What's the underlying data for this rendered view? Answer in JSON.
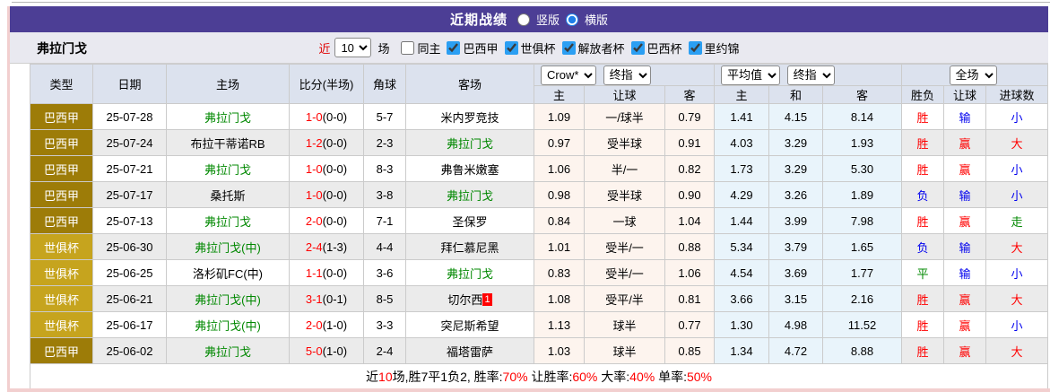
{
  "topbar": {
    "title": "近期战绩",
    "radio_vertical": "竖版",
    "radio_horizontal": "横版",
    "bar_color": "#4c3e95"
  },
  "filter": {
    "team": "弗拉门戈",
    "recent_label": "近",
    "recent_value": "10",
    "games_label": "场",
    "checkboxes": [
      {
        "label": "同主",
        "checked": false
      },
      {
        "label": "巴西甲",
        "checked": true
      },
      {
        "label": "世俱杯",
        "checked": true
      },
      {
        "label": "解放者杯",
        "checked": true
      },
      {
        "label": "巴西杯",
        "checked": true
      },
      {
        "label": "里约锦",
        "checked": true
      }
    ]
  },
  "table": {
    "headers": {
      "type": "类型",
      "date": "日期",
      "home": "主场",
      "score": "比分(半场)",
      "corner": "角球",
      "away": "客场",
      "crow_select": "Crow*",
      "crow_final_select": "终指",
      "avg_select": "平均值",
      "avg_final_select": "终指",
      "scope_select": "全场",
      "sub_home": "主",
      "sub_handicap": "让球",
      "sub_away": "客",
      "sub_avg_home": "主",
      "sub_avg_draw": "和",
      "sub_avg_away": "客",
      "sub_result": "胜负",
      "sub_handicap_result": "让球",
      "sub_goals": "进球数"
    },
    "type_colors": {
      "league": "#9d7c08",
      "cup": "#c6a41e"
    },
    "rows": [
      {
        "type": "巴西甲",
        "type_style": "league",
        "date": "25-07-28",
        "home": "弗拉门戈",
        "home_color": "green",
        "score": "1-0",
        "half": "(0-0)",
        "corner": "5-7",
        "away": "米内罗竞技",
        "away_color": "black",
        "away_badge": "",
        "odds_home": "1.09",
        "handicap": "一/球半",
        "odds_away": "0.79",
        "avg_home": "1.41",
        "avg_draw": "4.15",
        "avg_away": "8.14",
        "result": "胜",
        "result_color": "red",
        "hresult": "输",
        "hresult_color": "blue",
        "goals": "小",
        "goals_color": "blue"
      },
      {
        "type": "巴西甲",
        "type_style": "league",
        "date": "25-07-24",
        "home": "布拉干蒂诺RB",
        "home_color": "black",
        "score": "1-2",
        "half": "(0-0)",
        "corner": "2-3",
        "away": "弗拉门戈",
        "away_color": "green",
        "away_badge": "",
        "odds_home": "0.97",
        "handicap": "受半球",
        "odds_away": "0.91",
        "avg_home": "4.03",
        "avg_draw": "3.29",
        "avg_away": "1.93",
        "result": "胜",
        "result_color": "red",
        "hresult": "赢",
        "hresult_color": "red",
        "goals": "大",
        "goals_color": "red"
      },
      {
        "type": "巴西甲",
        "type_style": "league",
        "date": "25-07-21",
        "home": "弗拉门戈",
        "home_color": "green",
        "score": "1-0",
        "half": "(0-0)",
        "corner": "8-3",
        "away": "弗鲁米嫩塞",
        "away_color": "black",
        "away_badge": "",
        "odds_home": "1.06",
        "handicap": "半/一",
        "odds_away": "0.82",
        "avg_home": "1.73",
        "avg_draw": "3.29",
        "avg_away": "5.30",
        "result": "胜",
        "result_color": "red",
        "hresult": "赢",
        "hresult_color": "red",
        "goals": "小",
        "goals_color": "blue"
      },
      {
        "type": "巴西甲",
        "type_style": "league",
        "date": "25-07-17",
        "home": "桑托斯",
        "home_color": "black",
        "score": "1-0",
        "half": "(0-0)",
        "corner": "3-8",
        "away": "弗拉门戈",
        "away_color": "green",
        "away_badge": "",
        "odds_home": "0.98",
        "handicap": "受半球",
        "odds_away": "0.90",
        "avg_home": "4.29",
        "avg_draw": "3.26",
        "avg_away": "1.89",
        "result": "负",
        "result_color": "blue",
        "hresult": "输",
        "hresult_color": "blue",
        "goals": "小",
        "goals_color": "blue"
      },
      {
        "type": "巴西甲",
        "type_style": "league",
        "date": "25-07-13",
        "home": "弗拉门戈",
        "home_color": "green",
        "score": "2-0",
        "half": "(0-0)",
        "corner": "7-1",
        "away": "圣保罗",
        "away_color": "black",
        "away_badge": "",
        "odds_home": "0.84",
        "handicap": "一球",
        "odds_away": "1.04",
        "avg_home": "1.44",
        "avg_draw": "3.99",
        "avg_away": "7.98",
        "result": "胜",
        "result_color": "red",
        "hresult": "赢",
        "hresult_color": "red",
        "goals": "走",
        "goals_color": "green"
      },
      {
        "type": "世俱杯",
        "type_style": "cup",
        "date": "25-06-30",
        "home": "弗拉门戈(中)",
        "home_color": "green",
        "score": "2-4",
        "half": "(1-3)",
        "corner": "4-4",
        "away": "拜仁慕尼黑",
        "away_color": "black",
        "away_badge": "",
        "odds_home": "1.01",
        "handicap": "受半/一",
        "odds_away": "0.88",
        "avg_home": "5.34",
        "avg_draw": "3.79",
        "avg_away": "1.65",
        "result": "负",
        "result_color": "blue",
        "hresult": "输",
        "hresult_color": "blue",
        "goals": "大",
        "goals_color": "red"
      },
      {
        "type": "世俱杯",
        "type_style": "cup",
        "date": "25-06-25",
        "home": "洛杉矶FC(中)",
        "home_color": "black",
        "score": "1-1",
        "half": "(0-0)",
        "corner": "3-6",
        "away": "弗拉门戈",
        "away_color": "green",
        "away_badge": "",
        "odds_home": "0.83",
        "handicap": "受半/一",
        "odds_away": "1.06",
        "avg_home": "4.54",
        "avg_draw": "3.69",
        "avg_away": "1.77",
        "result": "平",
        "result_color": "green",
        "hresult": "输",
        "hresult_color": "blue",
        "goals": "小",
        "goals_color": "blue"
      },
      {
        "type": "世俱杯",
        "type_style": "cup",
        "date": "25-06-21",
        "home": "弗拉门戈(中)",
        "home_color": "green",
        "score": "3-1",
        "half": "(0-1)",
        "corner": "8-5",
        "away": "切尔西",
        "away_color": "black",
        "away_badge": "1",
        "odds_home": "1.08",
        "handicap": "受平/半",
        "odds_away": "0.81",
        "avg_home": "3.66",
        "avg_draw": "3.15",
        "avg_away": "2.16",
        "result": "胜",
        "result_color": "red",
        "hresult": "赢",
        "hresult_color": "red",
        "goals": "大",
        "goals_color": "red"
      },
      {
        "type": "世俱杯",
        "type_style": "cup",
        "date": "25-06-17",
        "home": "弗拉门戈(中)",
        "home_color": "green",
        "score": "2-0",
        "half": "(1-0)",
        "corner": "3-3",
        "away": "突尼斯希望",
        "away_color": "black",
        "away_badge": "",
        "odds_home": "1.13",
        "handicap": "球半",
        "odds_away": "0.77",
        "avg_home": "1.30",
        "avg_draw": "4.98",
        "avg_away": "11.52",
        "result": "胜",
        "result_color": "red",
        "hresult": "赢",
        "hresult_color": "red",
        "goals": "小",
        "goals_color": "blue"
      },
      {
        "type": "巴西甲",
        "type_style": "league",
        "date": "25-06-02",
        "home": "弗拉门戈",
        "home_color": "green",
        "score": "5-0",
        "half": "(1-0)",
        "corner": "2-4",
        "away": "福塔雷萨",
        "away_color": "black",
        "away_badge": "",
        "odds_home": "1.03",
        "handicap": "球半",
        "odds_away": "0.85",
        "avg_home": "1.34",
        "avg_draw": "4.72",
        "avg_away": "8.88",
        "result": "胜",
        "result_color": "red",
        "hresult": "赢",
        "hresult_color": "red",
        "goals": "大",
        "goals_color": "red"
      }
    ]
  },
  "footer": {
    "seg1": "近",
    "seg2": "10",
    "seg3": "场,胜7平1负2, 胜率:",
    "seg4": "70%",
    "seg5": " 让胜率:",
    "seg6": "60%",
    "seg7": " 大率:",
    "seg8": "40%",
    "seg9": " 单率:",
    "seg10": "50%"
  }
}
